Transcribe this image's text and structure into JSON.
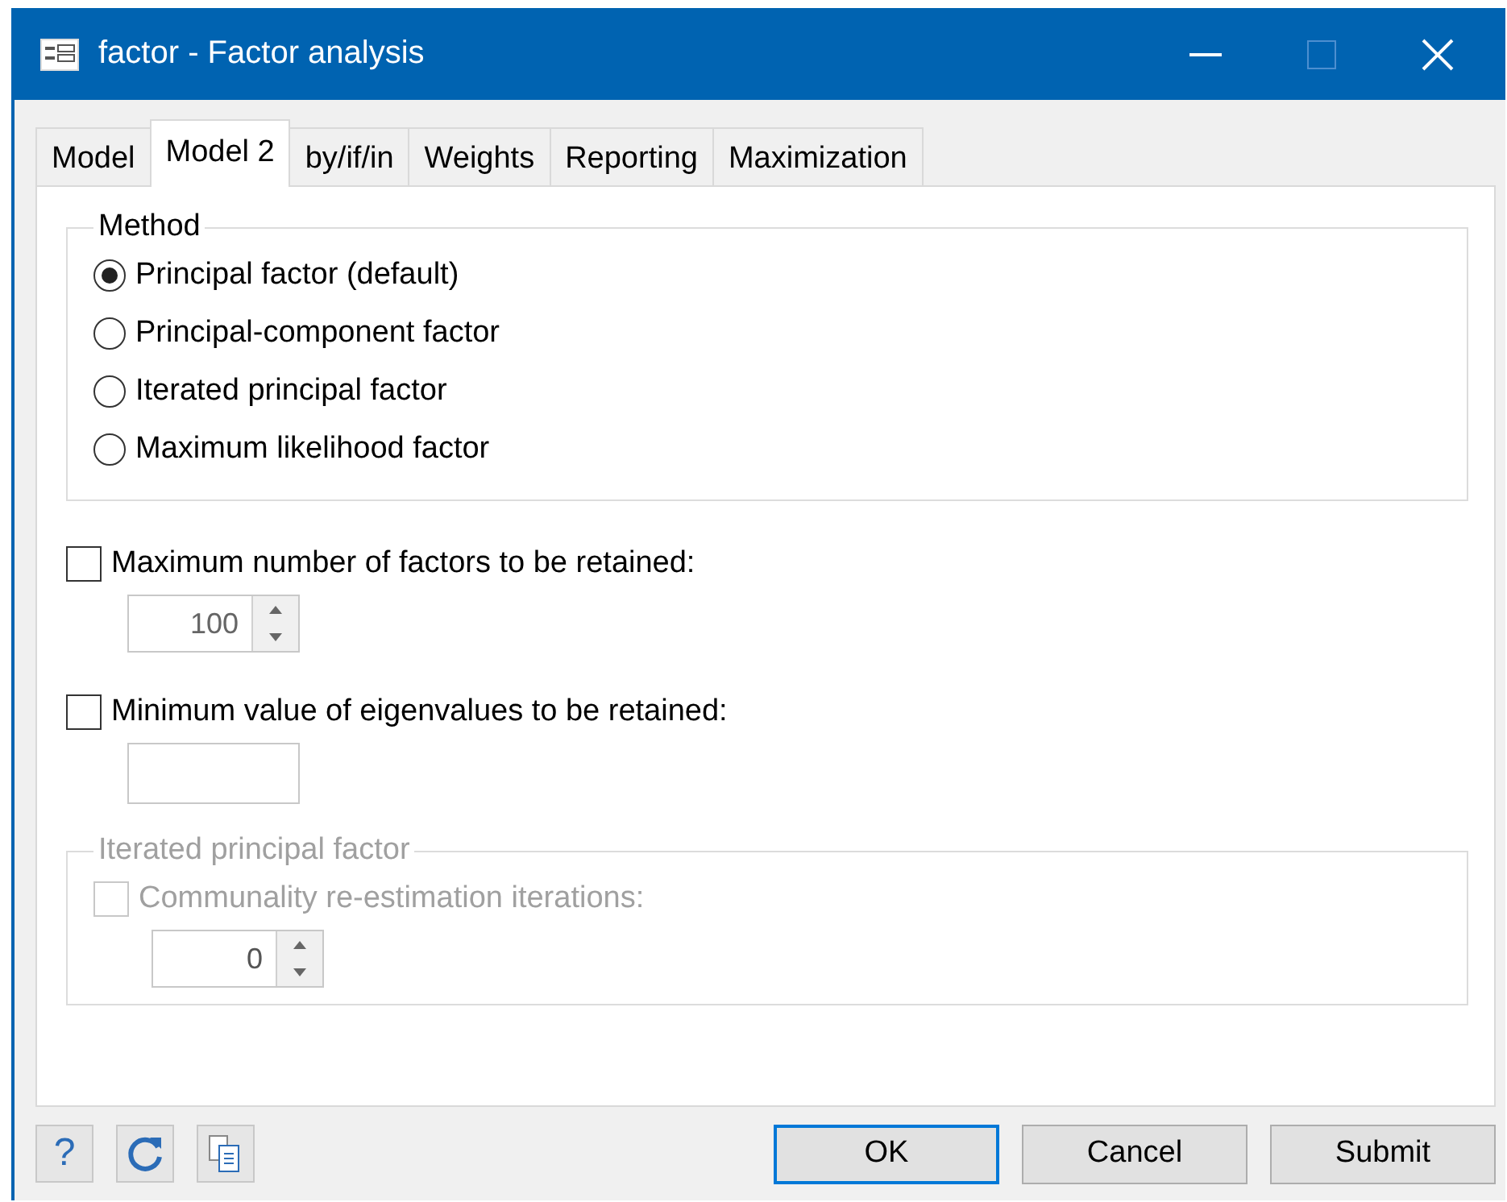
{
  "window": {
    "title": "factor - Factor analysis"
  },
  "tabs": [
    {
      "label": "Model",
      "selected": false
    },
    {
      "label": "Model 2",
      "selected": true
    },
    {
      "label": "by/if/in",
      "selected": false
    },
    {
      "label": "Weights",
      "selected": false
    },
    {
      "label": "Reporting",
      "selected": false
    },
    {
      "label": "Maximization",
      "selected": false
    }
  ],
  "method": {
    "legend": "Method",
    "options": [
      {
        "label": "Principal factor (default)",
        "selected": true
      },
      {
        "label": "Principal-component factor",
        "selected": false
      },
      {
        "label": "Iterated principal factor",
        "selected": false
      },
      {
        "label": "Maximum likelihood factor",
        "selected": false
      }
    ]
  },
  "options": [
    {
      "label": "Maximum number of factors to be retained:",
      "checked": false,
      "kind": "spinner",
      "value": "100"
    },
    {
      "label": "Minimum value of eigenvalues to be retained:",
      "checked": false,
      "kind": "field"
    }
  ],
  "iterated": {
    "legend": "Iterated principal factor",
    "disabled": true,
    "option": {
      "label": "Communality re-estimation iterations:",
      "checked": false,
      "kind": "spinner",
      "value": "0"
    }
  },
  "footer": {
    "help": "?",
    "buttons": [
      {
        "label": "OK",
        "default": true
      },
      {
        "label": "Cancel",
        "default": false
      },
      {
        "label": "Submit",
        "default": false
      }
    ]
  }
}
